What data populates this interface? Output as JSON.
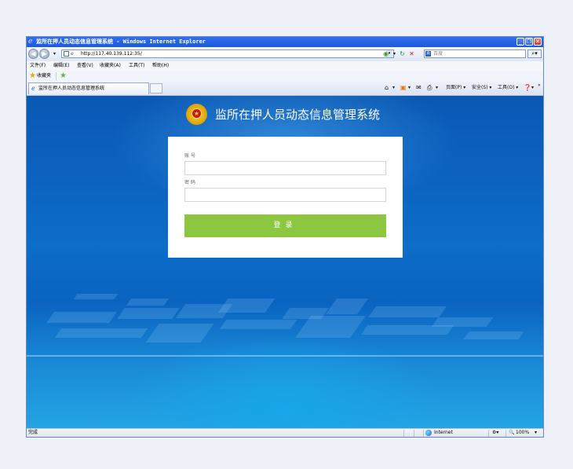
{
  "window": {
    "title": "监所在押人员动态信息管理系统 - Windows Internet Explorer",
    "minimize": "_",
    "restore": "❐",
    "close": "✕"
  },
  "address_bar": {
    "url": "http://117.40.139.112:35/",
    "search_placeholder": "百度"
  },
  "menu": {
    "items": [
      "文件(F)",
      "编辑(E)",
      "查看(V)",
      "收藏夹(A)",
      "工具(T)",
      "帮助(H)"
    ]
  },
  "favorites_bar": {
    "label": "收藏夹"
  },
  "tab": {
    "title": "监所在押人员动态信息管理系统"
  },
  "command_bar": {
    "page": "页面(P) ▾",
    "safety": "安全(S) ▾",
    "tools": "工具(O) ▾",
    "more": "»"
  },
  "page": {
    "system_title": "监所在押人员动态信息管理系统",
    "account_label": "账号",
    "account_value": "",
    "password_label": "密码",
    "password_value": "",
    "login_button": "登录"
  },
  "status_bar": {
    "status": "完成",
    "zone": "Internet",
    "zoom": "100%"
  },
  "colors": {
    "accent_green": "#8dc63f",
    "background_blue": "#0a63c0",
    "titlebar_blue": "#2f6ff0"
  }
}
